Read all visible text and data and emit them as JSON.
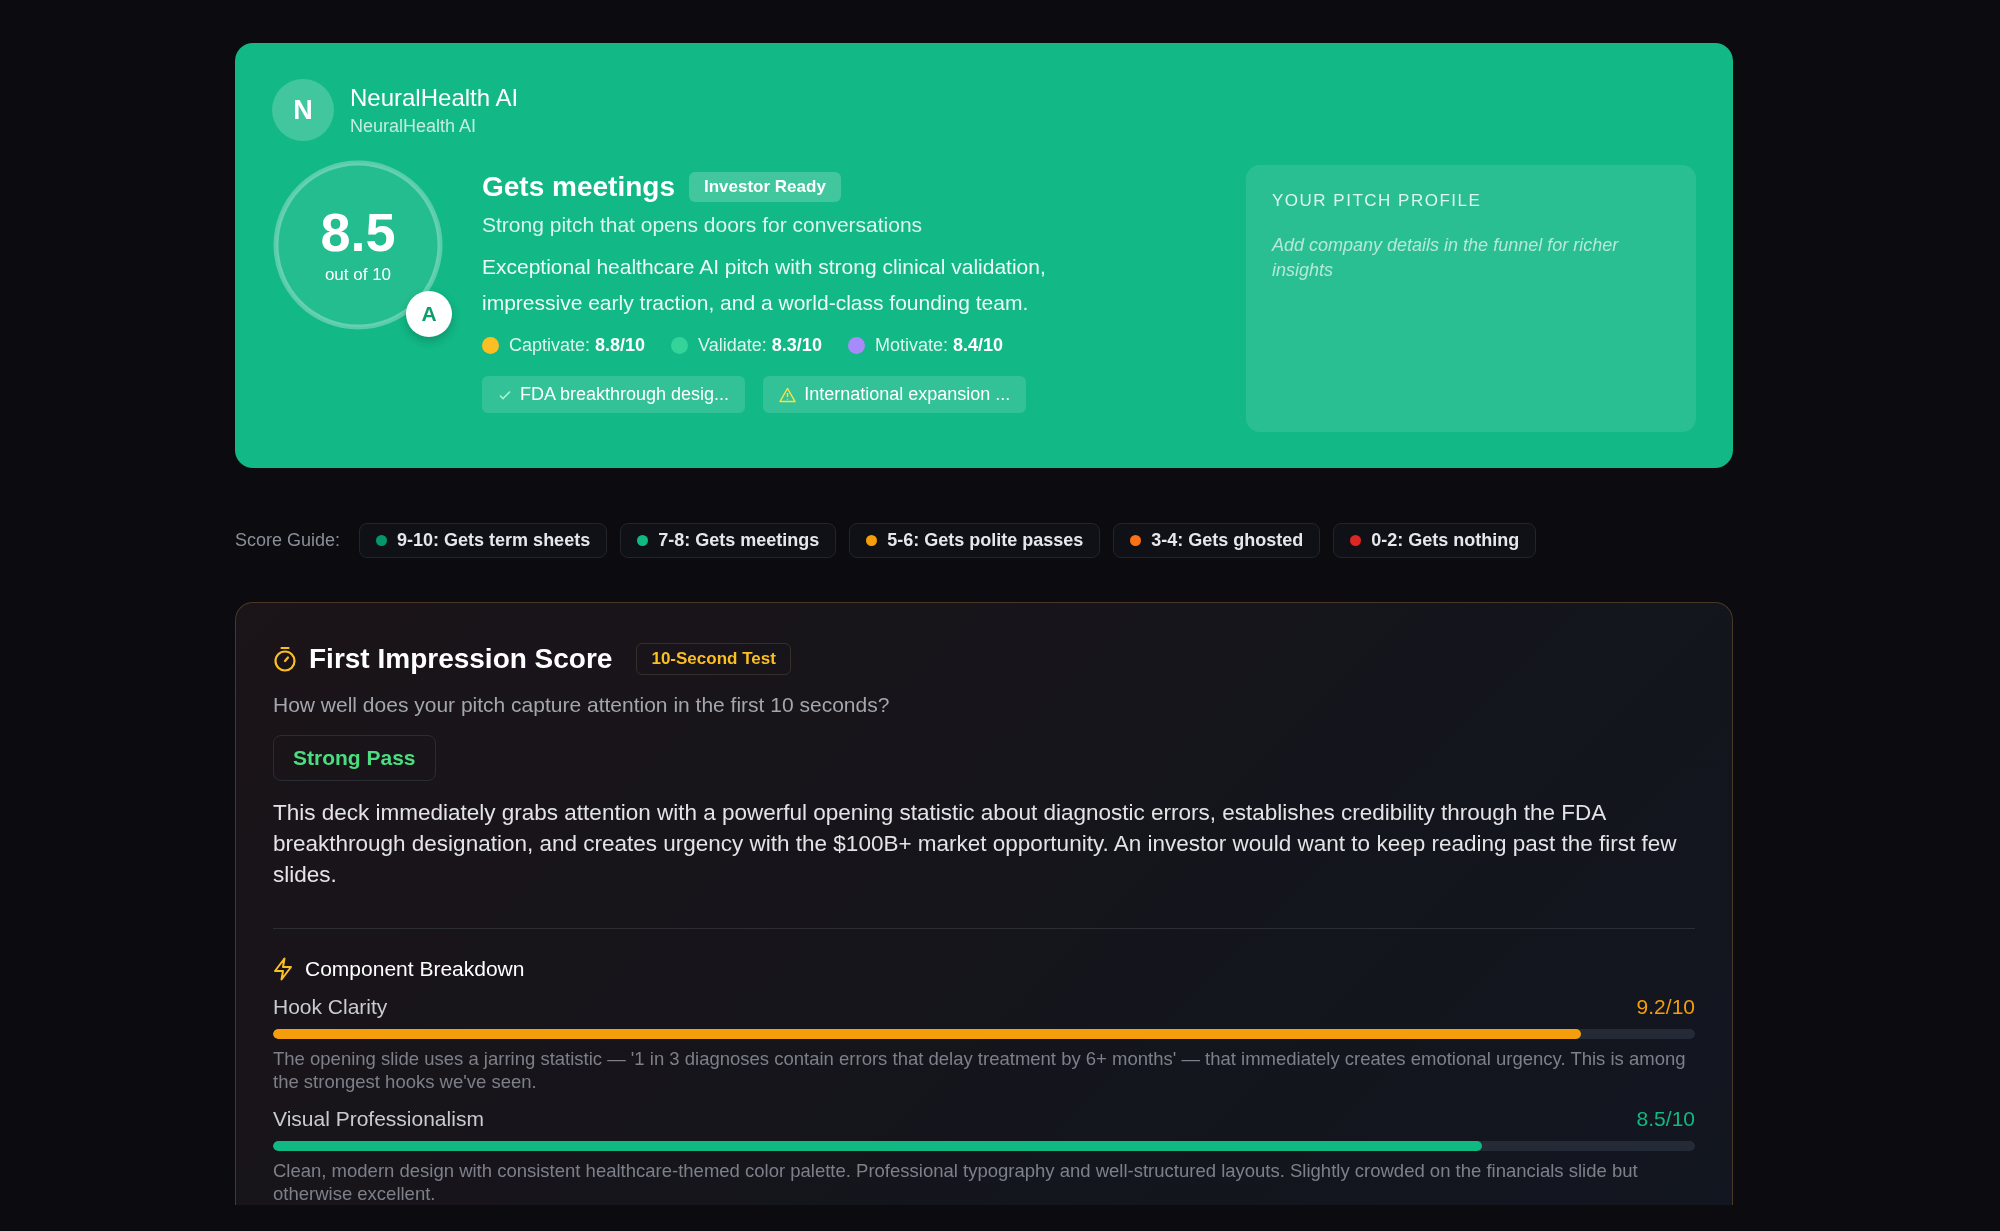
{
  "company": {
    "initial": "N",
    "name": "NeuralHealth AI",
    "subtitle": "NeuralHealth AI"
  },
  "score": {
    "value": "8.5",
    "scale": "out of 10",
    "grade": "A"
  },
  "verdict": {
    "title": "Gets meetings",
    "badge": "Investor Ready",
    "tagline": "Strong pitch that opens doors for conversations",
    "summary": "Exceptional healthcare AI pitch with strong clinical validation, impressive early traction, and a world-class founding team."
  },
  "metrics": [
    {
      "label": "Captivate:",
      "value": "8.8/10",
      "color": "#fbbf24"
    },
    {
      "label": "Validate:",
      "value": "8.3/10",
      "color": "#34d399"
    },
    {
      "label": "Motivate:",
      "value": "8.4/10",
      "color": "#a78bfa"
    }
  ],
  "highlights": [
    {
      "kind": "strength",
      "text": "FDA breakthrough desig..."
    },
    {
      "kind": "warning",
      "text": "International expansion ..."
    }
  ],
  "profile": {
    "heading": "YOUR PITCH PROFILE",
    "note": "Add company details in the funnel for richer insights"
  },
  "score_guide": {
    "label": "Score Guide:",
    "items": [
      {
        "text": "9-10: Gets term sheets",
        "color": "#059669"
      },
      {
        "text": "7-8: Gets meetings",
        "color": "#10b981"
      },
      {
        "text": "5-6: Gets polite passes",
        "color": "#f59e0b"
      },
      {
        "text": "3-4: Gets ghosted",
        "color": "#f97316"
      },
      {
        "text": "0-2: Gets nothing",
        "color": "#dc2626"
      }
    ]
  },
  "first_impression": {
    "title": "First Impression Score",
    "badge": "10-Second Test",
    "question": "How well does your pitch capture attention in the first 10 seconds?",
    "result": "Strong Pass",
    "analysis": "This deck immediately grabs attention with a powerful opening statistic about diagnostic errors, establishes credibility through the FDA breakthrough designation, and creates urgency with the $100B+ market opportunity. An investor would want to keep reading past the first few slides.",
    "breakdown_title": "Component Breakdown",
    "components": [
      {
        "name": "Hook Clarity",
        "score": "9.2/10",
        "level": 0.92,
        "color": "#f59e0b",
        "note": "The opening slide uses a jarring statistic — '1 in 3 diagnoses contain errors that delay treatment by 6+ months' — that immediately creates emotional urgency. This is among the strongest hooks we've seen."
      },
      {
        "name": "Visual Professionalism",
        "score": "8.5/10",
        "level": 0.85,
        "color": "#10b981",
        "note": "Clean, modern design with consistent healthcare-themed color palette. Professional typography and well-structured layouts. Slightly crowded on the financials slide but otherwise excellent."
      }
    ]
  }
}
